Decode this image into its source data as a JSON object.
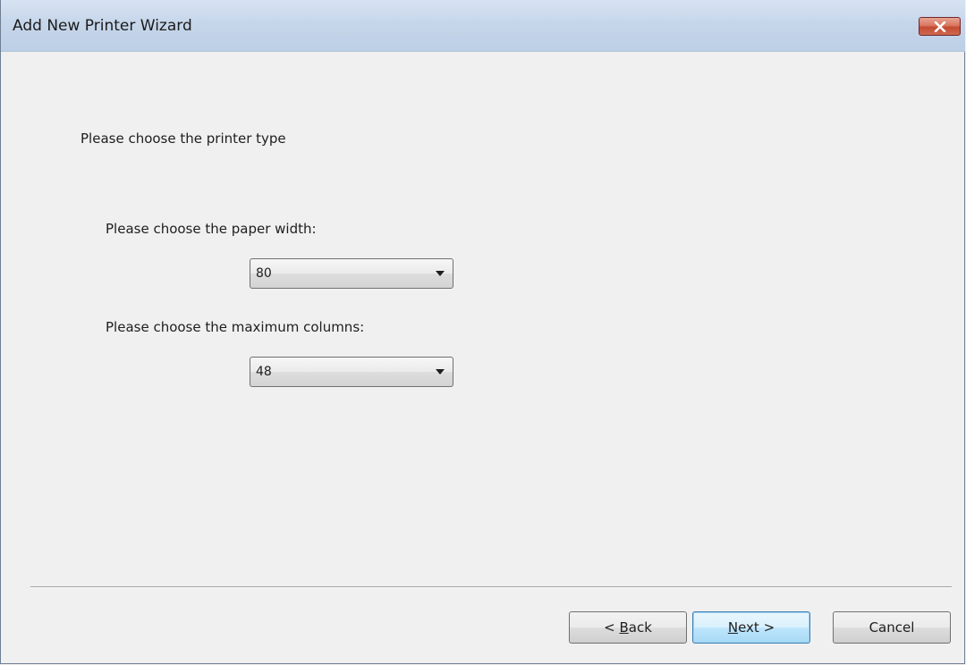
{
  "window": {
    "title": "Add New Printer Wizard",
    "close_icon": "close-icon"
  },
  "wizard": {
    "heading": "Please choose the printer type",
    "paper_width": {
      "label": "Please choose the paper width:",
      "selected": "80"
    },
    "max_columns": {
      "label": "Please choose the maximum columns:",
      "selected": "48"
    }
  },
  "buttons": {
    "back": {
      "prefix": "< ",
      "accel": "B",
      "rest": "ack"
    },
    "next": {
      "accel": "N",
      "rest": "ext >"
    },
    "cancel": "Cancel"
  },
  "colors": {
    "default_button_border": "#3c7fb1",
    "close_button": "#c44a32"
  }
}
